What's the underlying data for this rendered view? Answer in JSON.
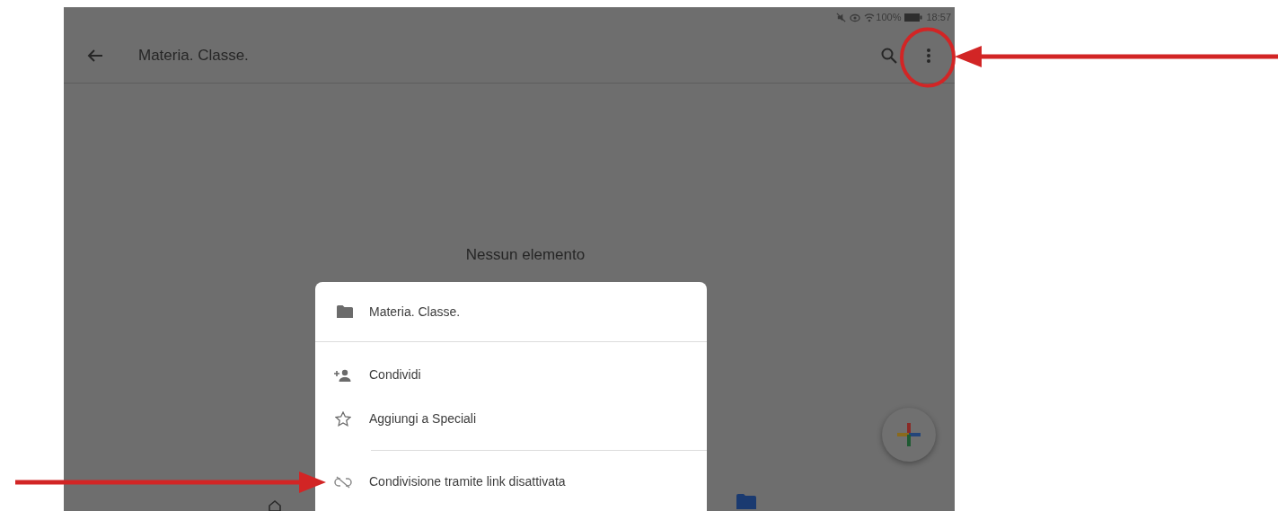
{
  "status_bar": {
    "battery": "100%",
    "time": "18:57"
  },
  "app_bar": {
    "title": "Materia. Classe."
  },
  "empty_state": {
    "message": "Nessun elemento"
  },
  "sheet": {
    "title": "Materia. Classe.",
    "items": [
      {
        "kind": "share",
        "label": "Condividi",
        "divider_before": false
      },
      {
        "kind": "star",
        "label": "Aggiungi a Speciali",
        "divider_before": false
      },
      {
        "kind": "link-off",
        "label": "Condivisione tramite link disattivata",
        "divider_before": true
      }
    ]
  }
}
